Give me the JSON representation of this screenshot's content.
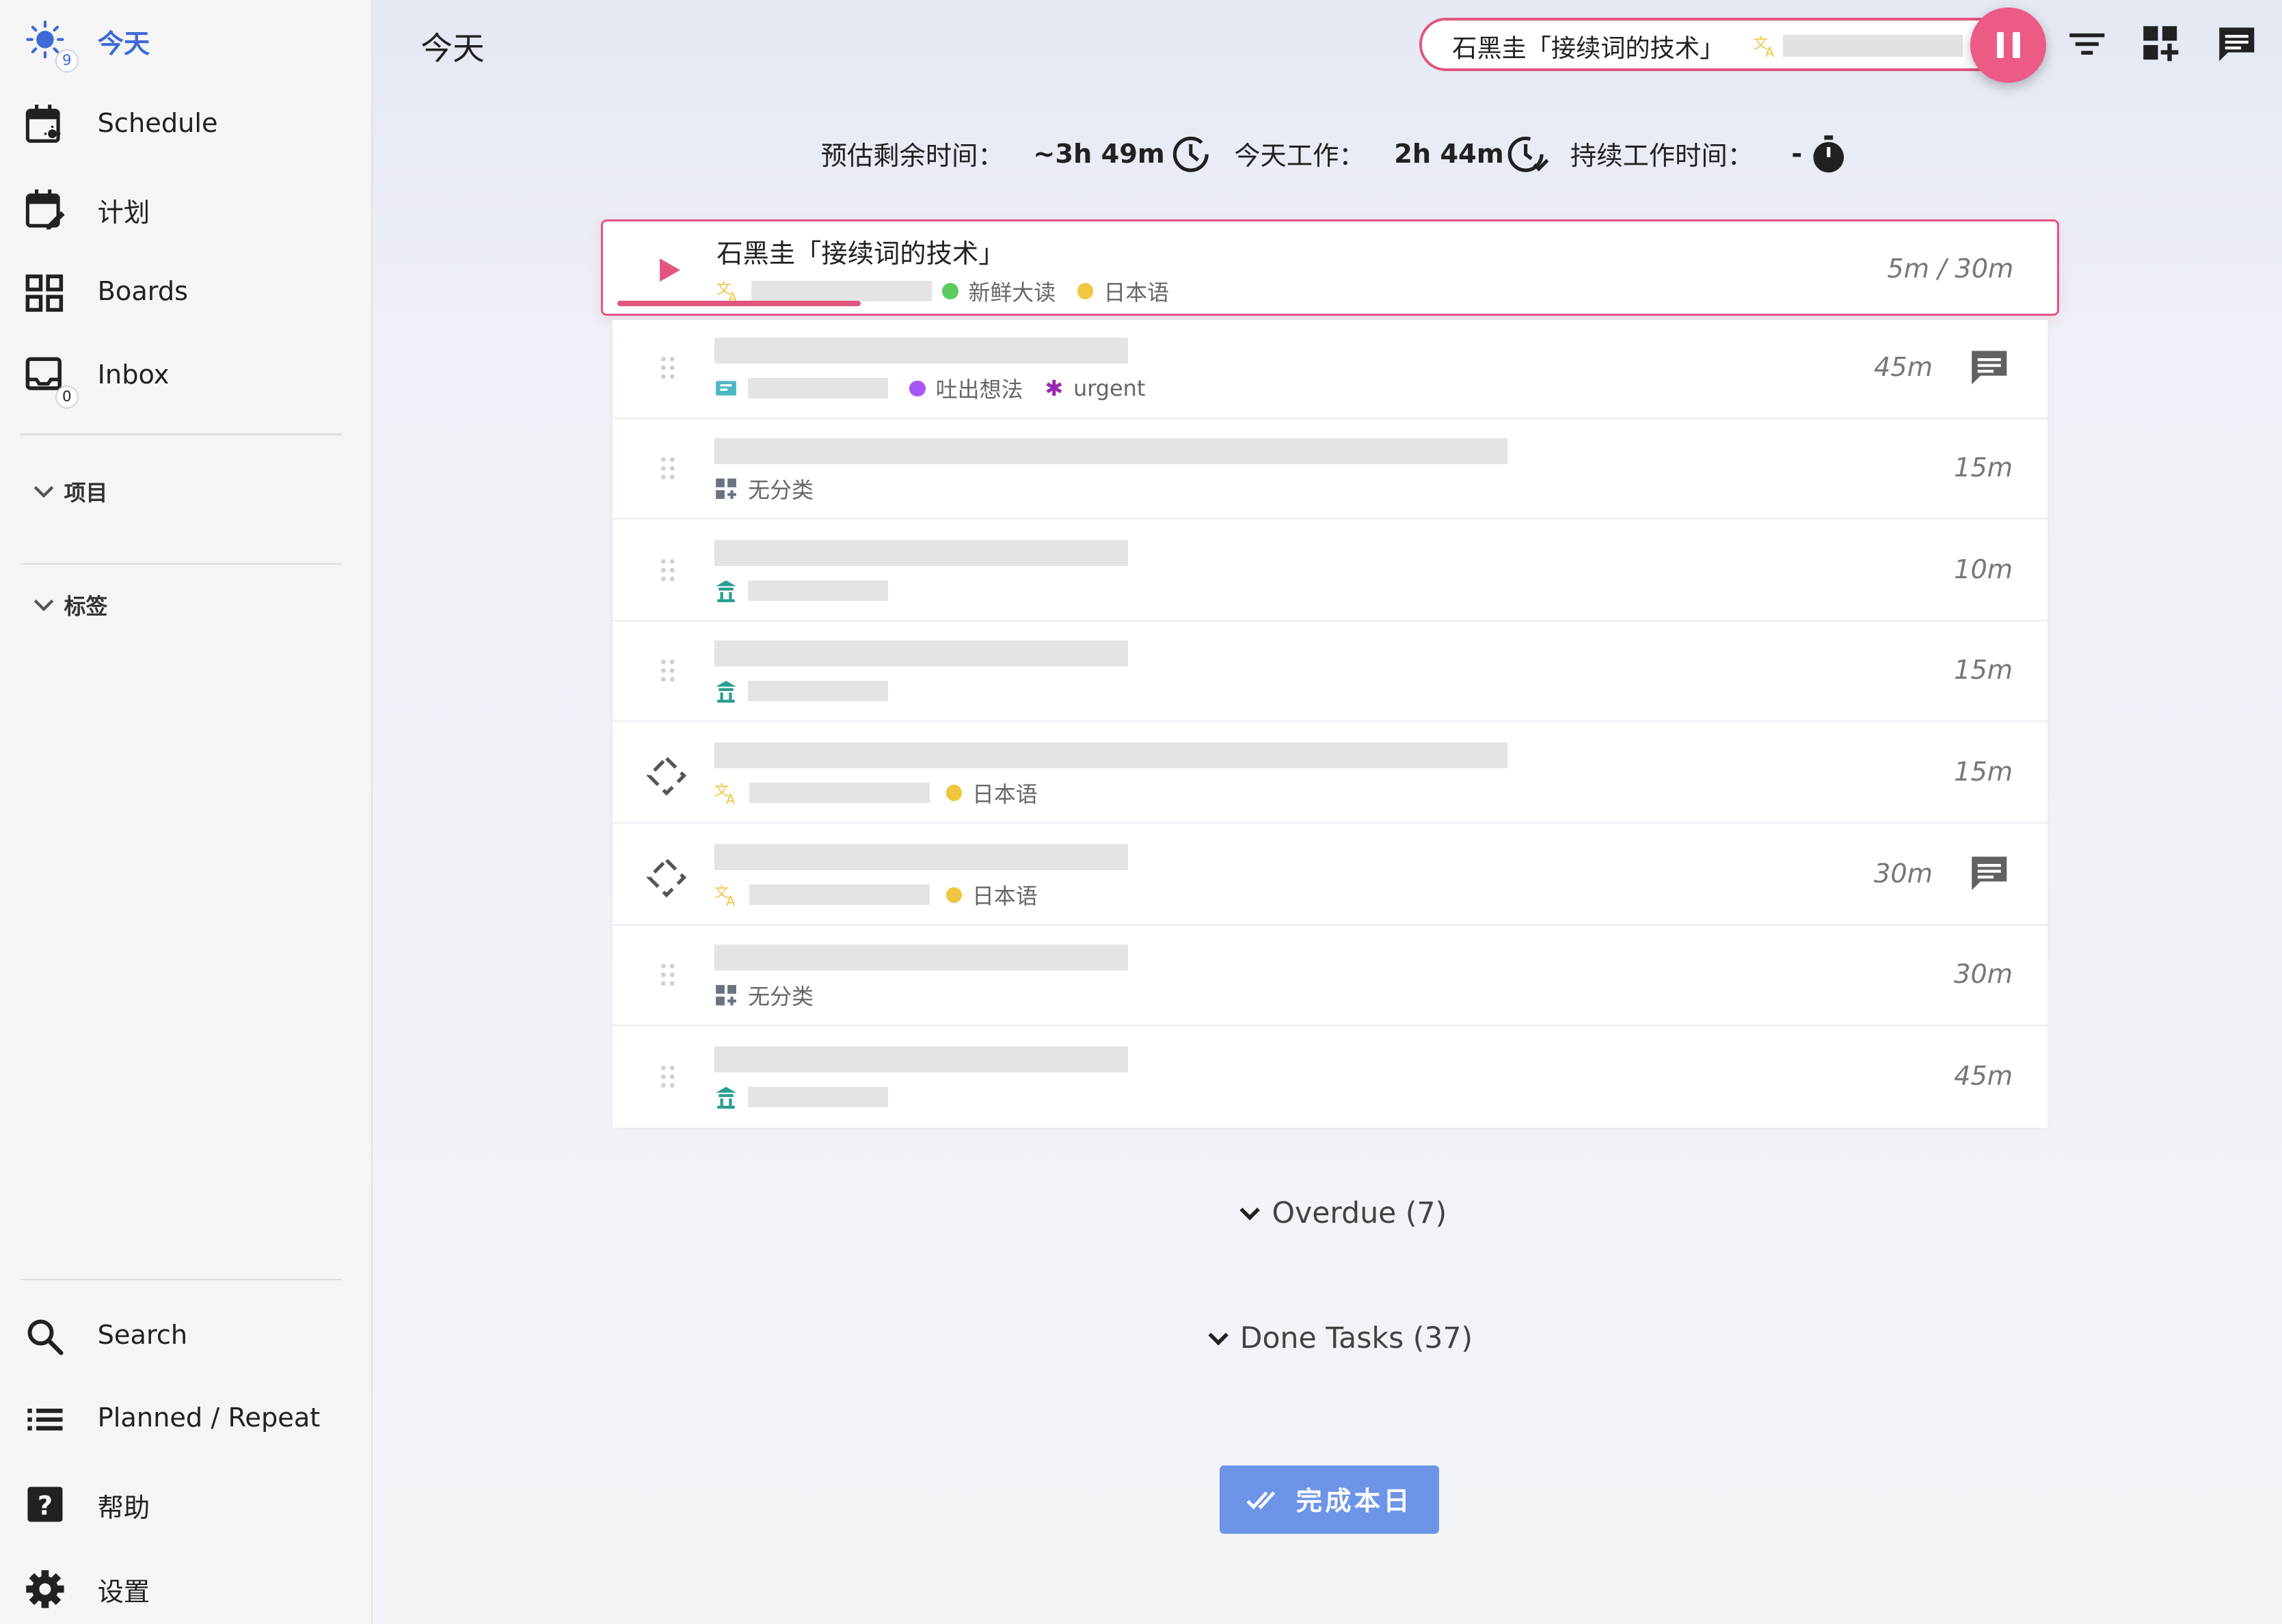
{
  "sidebar": {
    "items": [
      {
        "label": "今天",
        "badge": "9",
        "icon": "sun-icon"
      },
      {
        "label": "Schedule",
        "icon": "schedule-icon"
      },
      {
        "label": "计划",
        "icon": "calendar-edit-icon"
      },
      {
        "label": "Boards",
        "icon": "grid-icon"
      },
      {
        "label": "Inbox",
        "badge": "0",
        "icon": "inbox-icon"
      }
    ],
    "sections": [
      {
        "label": "项目"
      },
      {
        "label": "标签"
      }
    ],
    "bottom_items": [
      {
        "label": "Search",
        "icon": "search-icon"
      },
      {
        "label": "Planned / Repeat",
        "icon": "list-icon"
      },
      {
        "label": "帮助",
        "icon": "help-icon"
      },
      {
        "label": "设置",
        "icon": "gear-icon"
      }
    ]
  },
  "header": {
    "title": "今天",
    "current_task": "石黑圭「接续词的技术」"
  },
  "stats": {
    "remaining_label": "预估剩余时间：",
    "remaining_value": "~3h 49m",
    "worked_label": "今天工作：",
    "worked_value": "2h 44m",
    "continuous_label": "持续工作时间：",
    "continuous_value": "-"
  },
  "current_task": {
    "title": "石黑圭「接续词的技术」",
    "tags": [
      {
        "label": "新鲜大读",
        "color": "#5ccb5f"
      },
      {
        "label": "日本语",
        "color": "#f0c540"
      }
    ],
    "time": "5m / 30m",
    "progress": 0.17
  },
  "tasks": [
    {
      "time": "45m",
      "tags": [
        {
          "label": "吐出想法",
          "color": "#a855f7"
        },
        {
          "label": "urgent",
          "color": "#9c27b0"
        }
      ],
      "has_note": true
    },
    {
      "time": "15m",
      "tags": [
        {
          "label": "无分类"
        }
      ],
      "has_note": false
    },
    {
      "time": "10m",
      "tags": [],
      "has_note": false
    },
    {
      "time": "15m",
      "tags": [],
      "has_note": false
    },
    {
      "time": "15m",
      "tags": [
        {
          "label": "日本语",
          "color": "#f0c540"
        }
      ],
      "has_note": false
    },
    {
      "time": "30m",
      "tags": [
        {
          "label": "日本语",
          "color": "#f0c540"
        }
      ],
      "has_note": true
    },
    {
      "time": "30m",
      "tags": [
        {
          "label": "无分类"
        }
      ],
      "has_note": false
    },
    {
      "time": "45m",
      "tags": [],
      "has_note": false
    }
  ],
  "overdue_label": "Overdue (7)",
  "done_label": "Done Tasks (37)",
  "finish_day_label": "完成本日",
  "colors": {
    "accent": "#e2557f",
    "primary": "#6c95e8",
    "active_nav": "#3f6ad8"
  }
}
